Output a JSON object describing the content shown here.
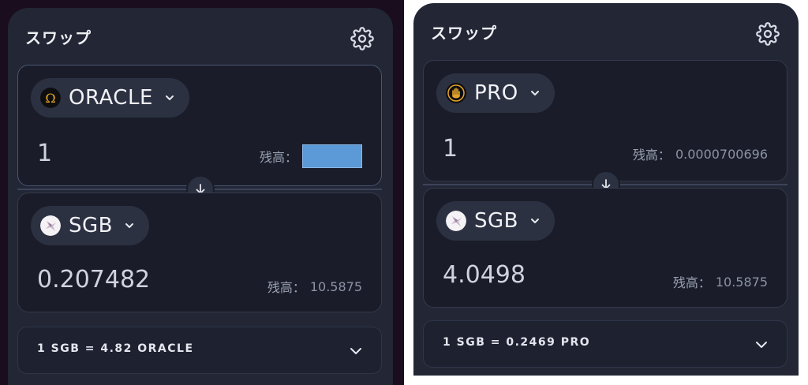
{
  "left": {
    "title": "スワップ",
    "from": {
      "token": "ORACLE",
      "amount": "1",
      "balance_label": "残高："
    },
    "to": {
      "token": "SGB",
      "amount": "0.207482",
      "balance_label": "残高：",
      "balance_value": "10.5875"
    },
    "rate": "1 SGB = 4.82 ORACLE"
  },
  "right": {
    "title": "スワップ",
    "from": {
      "token": "PRO",
      "amount": "1",
      "balance_label": "残高：",
      "balance_value": "0.0000700696"
    },
    "to": {
      "token": "SGB",
      "amount": "4.0498",
      "balance_label": "残高：",
      "balance_value": "10.5875"
    },
    "rate": "1 SGB = 0.2469 PRO"
  },
  "colors": {
    "panel_bg": "#222635",
    "card_bg": "#1a1d29",
    "pill_bg": "#2c3142",
    "balance_highlight": "#5c9ad7"
  },
  "icons": {
    "settings": "gear-icon",
    "token_select": "chevron-down-icon",
    "swap_direction": "arrow-down-icon",
    "rate_expand": "chevron-down-icon"
  }
}
